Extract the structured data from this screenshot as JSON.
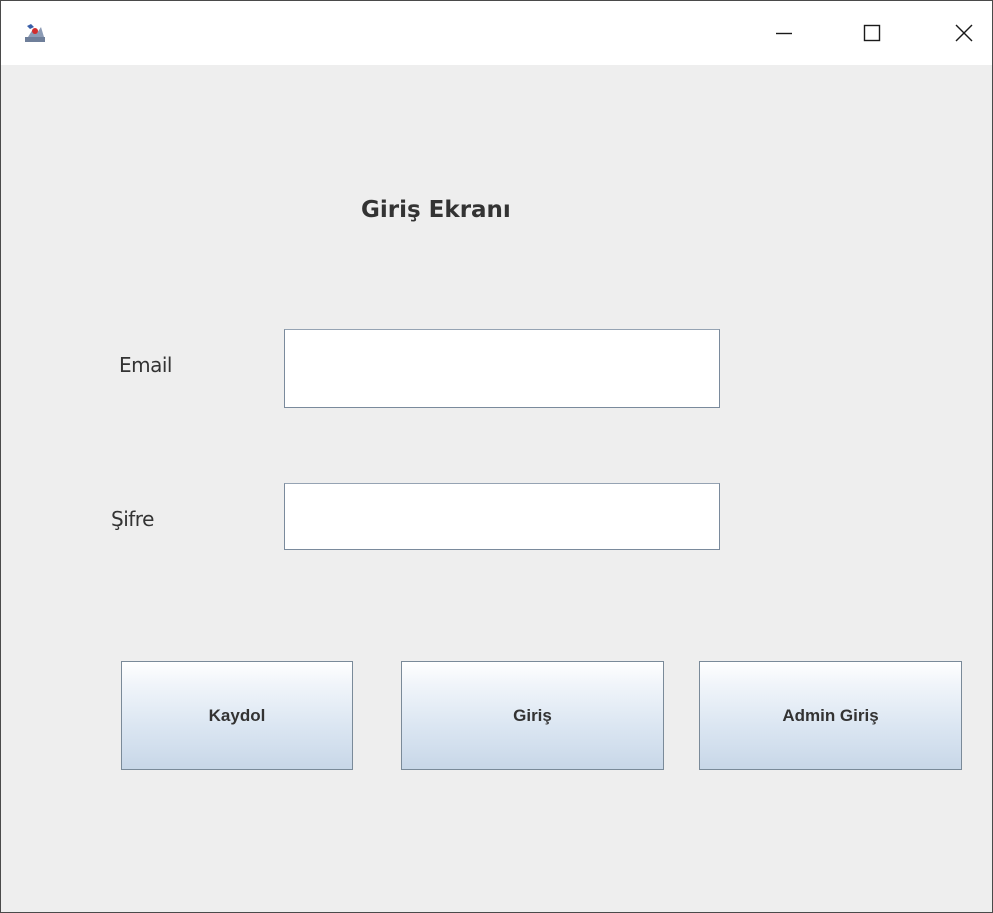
{
  "window": {
    "icon": "java-app-icon",
    "controls": {
      "minimize_icon": "minimize-icon",
      "maximize_icon": "maximize-icon",
      "close_icon": "close-icon"
    }
  },
  "form": {
    "title": "Giriş Ekranı",
    "email_label": "Email",
    "email_value": "",
    "password_label": "Şifre",
    "password_value": ""
  },
  "buttons": {
    "register": "Kaydol",
    "login": "Giriş",
    "admin_login": "Admin Giriş"
  },
  "colors": {
    "background": "#eeeeee",
    "button_top": "#ffffff",
    "button_bottom": "#c8d7e8",
    "border": "#7a8a99",
    "text": "#333333"
  }
}
